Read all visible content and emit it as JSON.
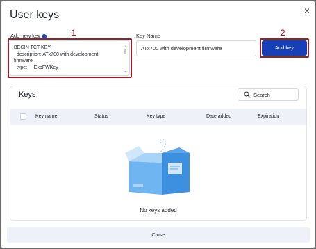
{
  "dialog": {
    "title": "User keys",
    "close_glyph": "×"
  },
  "add_key": {
    "label": "Add new key",
    "info_glyph": "i",
    "lines": [
      "BEGIN TCT KEY",
      "  description: ATx700 with development",
      "firmware",
      "  type:     ExpFWKey"
    ]
  },
  "key_name": {
    "label": "Key Name",
    "value": "ATx700 with development firmware"
  },
  "add_button": {
    "label": "Add key"
  },
  "callouts": {
    "one": "1",
    "two": "2"
  },
  "keys_panel": {
    "title": "Keys",
    "search_placeholder": "Search",
    "columns": [
      "Key name",
      "Status",
      "Key type",
      "Date added",
      "Expiration"
    ],
    "empty_text": "No keys added"
  },
  "footer": {
    "close_label": "Close"
  },
  "colors": {
    "primary": "#1740b8",
    "callout": "#a01c28",
    "header_bg": "#eef1f7",
    "illustration": "#5ca9ee"
  }
}
